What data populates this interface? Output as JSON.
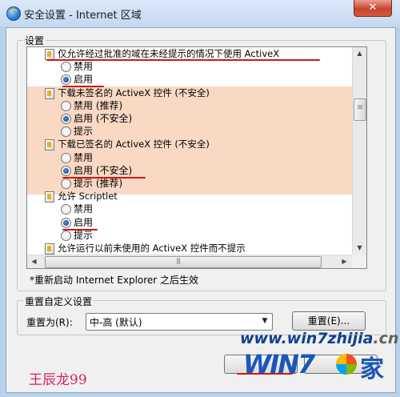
{
  "window": {
    "title": "安全设置 - Internet 区域",
    "close_label": "✕"
  },
  "settings_group": {
    "label": "设置"
  },
  "settings_list": [
    {
      "kind": "head",
      "text": "仅允许经过批准的域在未经提示的情况下使用 ActiveX"
    },
    {
      "kind": "opt",
      "text": "禁用",
      "checked": false
    },
    {
      "kind": "opt",
      "text": "启用",
      "checked": true
    },
    {
      "kind": "head",
      "text": "下载未签名的 ActiveX 控件 (不安全)"
    },
    {
      "kind": "opt",
      "text": "禁用 (推荐)",
      "checked": false
    },
    {
      "kind": "opt",
      "text": "启用 (不安全)",
      "checked": true
    },
    {
      "kind": "opt",
      "text": "提示",
      "checked": false
    },
    {
      "kind": "head",
      "text": "下载已签名的 ActiveX 控件 (不安全)"
    },
    {
      "kind": "opt",
      "text": "禁用",
      "checked": false
    },
    {
      "kind": "opt",
      "text": "启用 (不安全)",
      "checked": true
    },
    {
      "kind": "opt",
      "text": "提示 (推荐)",
      "checked": false
    },
    {
      "kind": "head",
      "text": "允许 Scriptlet"
    },
    {
      "kind": "opt",
      "text": "禁用",
      "checked": false
    },
    {
      "kind": "opt",
      "text": "启用",
      "checked": true
    },
    {
      "kind": "opt",
      "text": "提示",
      "checked": false
    },
    {
      "kind": "head",
      "text": "允许运行以前未使用的 ActiveX 控件而不提示"
    }
  ],
  "restart_note": "*重新启动 Internet Explorer 之后生效",
  "reset_group": {
    "label": "重置自定义设置",
    "reset_to_label": "重置为(R):",
    "selected_level": "中-高 (默认)",
    "reset_button": "重置(E)..."
  },
  "watermark": {
    "site_main": "www.win7zhijia",
    "site_tail": ".cn",
    "logo_text": "WIN7",
    "logo_suffix": "家"
  },
  "author": "王辰龙99",
  "colors": {
    "highlight": "#f9d9c4",
    "annotation_red": "#d01818",
    "title_bg": "#c2d8f0"
  }
}
